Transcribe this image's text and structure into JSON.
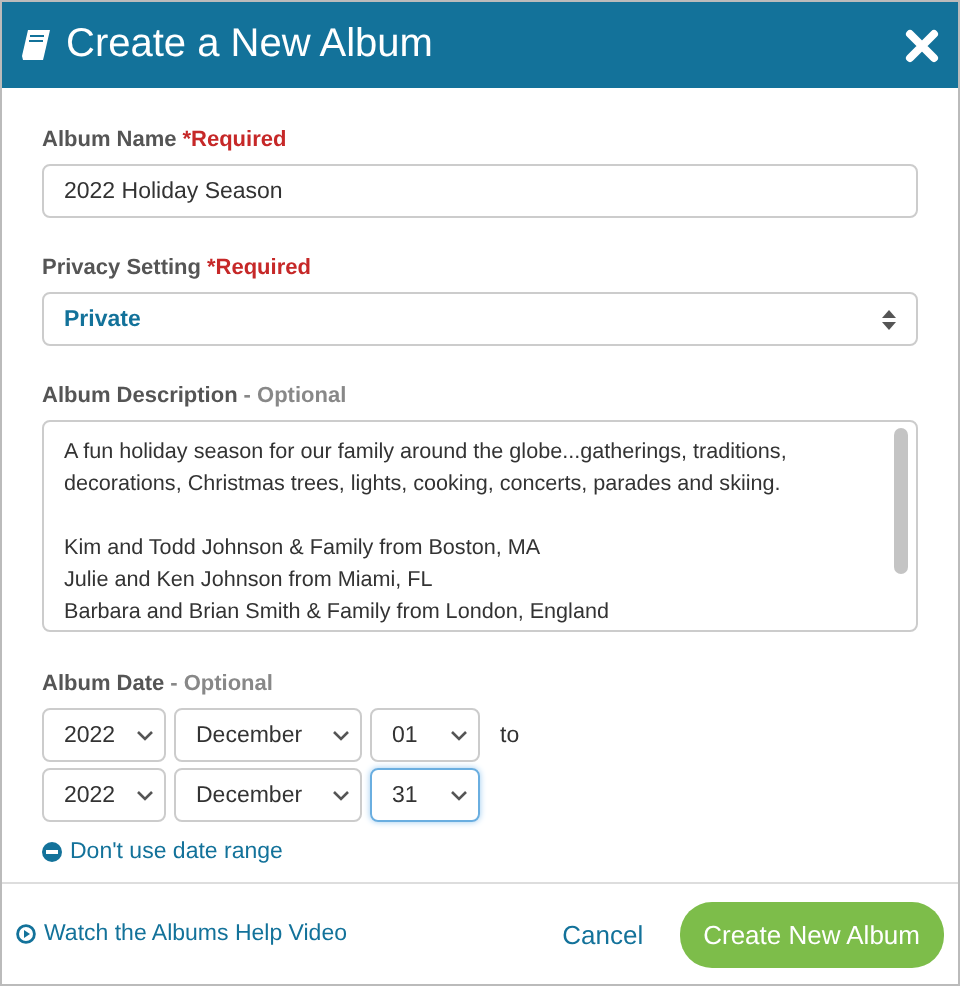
{
  "dialog": {
    "title": "Create a New Album"
  },
  "album_name": {
    "label": "Album Name",
    "required": "*Required",
    "value": "2022 Holiday Season"
  },
  "privacy": {
    "label": "Privacy Setting",
    "required": "*Required",
    "value": "Private"
  },
  "description": {
    "label": "Album Description",
    "optional": "- Optional",
    "paragraphs": [
      {
        "lines": [
          "A fun holiday season for our family around the globe...gatherings, traditions,",
          "decorations, Christmas trees, lights, cooking, concerts, parades and skiing."
        ]
      },
      {
        "lines": [
          "Kim and Todd Johnson & Family from Boston, MA",
          "Julie and Ken Johnson from Miami, FL",
          "Barbara and Brian Smith & Family from London, England"
        ]
      }
    ]
  },
  "album_date": {
    "label": "Album Date",
    "optional": "- Optional",
    "separator": "to",
    "rows": [
      {
        "fields": [
          {
            "kind": "year",
            "value": "2022",
            "focused": false
          },
          {
            "kind": "month",
            "value": "December",
            "focused": false
          },
          {
            "kind": "day",
            "value": "01",
            "focused": false
          }
        ]
      },
      {
        "fields": [
          {
            "kind": "year",
            "value": "2022",
            "focused": false
          },
          {
            "kind": "month",
            "value": "December",
            "focused": false
          },
          {
            "kind": "day",
            "value": "31",
            "focused": true
          }
        ]
      }
    ],
    "range_link": "Don't use date range"
  },
  "footer": {
    "help_link": "Watch the Albums Help Video",
    "cancel": "Cancel",
    "submit": "Create New Album"
  }
}
